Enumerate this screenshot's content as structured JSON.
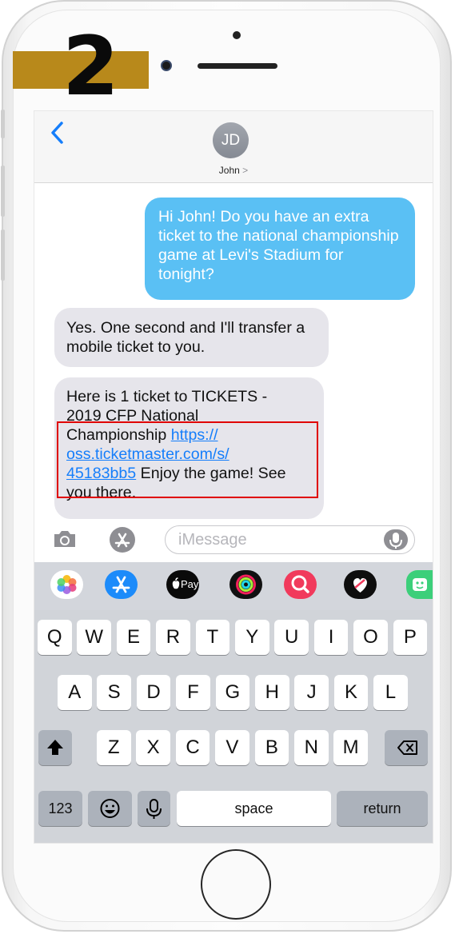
{
  "overlay": {
    "step_number": "2"
  },
  "header": {
    "back_icon": "chevron-left-icon",
    "avatar_initials": "JD",
    "contact_name": "John",
    "contact_chevron": ">"
  },
  "messages": {
    "outgoing_1": "Hi John! Do you have an extra ticket to the national championship game at Levi's Stadium for tonight?",
    "incoming_1": "Yes. One second and I'll transfer a mobile ticket to you.",
    "incoming_2": {
      "line1": "Here is 1 ticket to TICKETS -",
      "line2": "2019 CFP National",
      "line3_text": "Championship ",
      "link_part1": "https://",
      "link_part2": "oss.ticketmaster.com/s/",
      "link_part3": "45183bb5",
      "tail": " Enjoy the game! See you there."
    }
  },
  "compose": {
    "camera_icon": "camera-icon",
    "apps_icon": "app-store-icon",
    "placeholder": "iMessage",
    "mic_icon": "microphone-icon"
  },
  "app_strip": {
    "icons": [
      "photos-icon",
      "app-store-icon",
      "apple-pay-icon",
      "activity-icon",
      "image-search-icon",
      "digital-touch-icon",
      "sticker-app-icon"
    ],
    "apple_pay_label": "Pay",
    "colors": {
      "app_store": "#1c8bfa",
      "image_search": "#f13a5c",
      "sticker": "#3ccf7a"
    }
  },
  "keyboard": {
    "row1": [
      "Q",
      "W",
      "E",
      "R",
      "T",
      "Y",
      "U",
      "I",
      "O",
      "P"
    ],
    "row2": [
      "A",
      "S",
      "D",
      "F",
      "G",
      "H",
      "J",
      "K",
      "L"
    ],
    "row3": [
      "Z",
      "X",
      "C",
      "V",
      "B",
      "N",
      "M"
    ],
    "shift_icon": "shift-icon",
    "backspace_icon": "backspace-icon",
    "numbers_label": "123",
    "emoji_icon": "emoji-icon",
    "dictation_icon": "microphone-icon",
    "space_label": "space",
    "return_label": "return"
  },
  "colors": {
    "outgoing_bubble": "#5ac0f4",
    "incoming_bubble": "#e6e5eb",
    "link": "#157efb",
    "highlight": "#e00000",
    "step_banner": "#b8891b"
  }
}
